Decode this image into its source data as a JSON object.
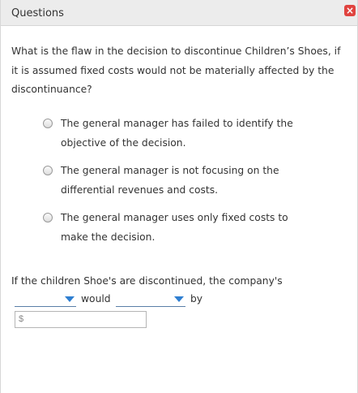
{
  "window": {
    "title": "Questions",
    "close_glyph": "×",
    "close_icon": "close-icon",
    "close_color": "#e0433f"
  },
  "question": {
    "text": "What is the flaw in the decision to discontinue Children’s Shoes, if it is assumed fixed costs would not be materially affected by the discontinuance?"
  },
  "options": [
    {
      "label": "The general manager has failed to identify the objective of the decision.",
      "selected": false
    },
    {
      "label": "The general manager is not focusing on the differential revenues and costs.",
      "selected": false
    },
    {
      "label": "The general manager uses only fixed costs to make the decision.",
      "selected": false
    }
  ],
  "fill_in": {
    "prompt": "If the children Shoe's are discontinued, the company's",
    "dropdown1_value": "",
    "word_would": "would",
    "dropdown2_value": "",
    "word_by": "by",
    "amount_placeholder": "$",
    "accent_color": "#2f7fd1"
  }
}
